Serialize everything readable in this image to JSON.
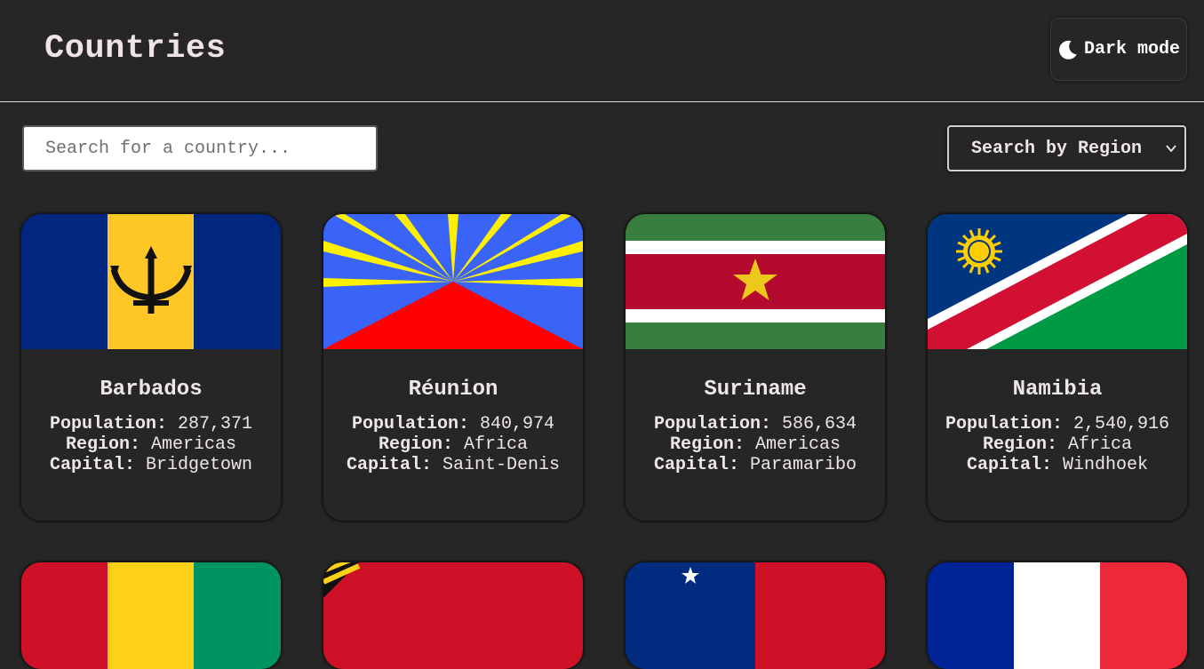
{
  "header": {
    "title": "Countries",
    "theme_toggle_label": "Dark mode",
    "theme_icon": "moon-icon"
  },
  "controls": {
    "search_placeholder": "Search for a country...",
    "search_value": "",
    "region_selected": "Search by Region"
  },
  "labels": {
    "population": "Population:",
    "region": "Region:",
    "capital": "Capital:"
  },
  "countries": [
    {
      "name": "Barbados",
      "population": "287,371",
      "region": "Americas",
      "capital": "Bridgetown"
    },
    {
      "name": "Réunion",
      "population": "840,974",
      "region": "Africa",
      "capital": "Saint-Denis"
    },
    {
      "name": "Suriname",
      "population": "586,634",
      "region": "Americas",
      "capital": "Paramaribo"
    },
    {
      "name": "Namibia",
      "population": "2,540,916",
      "region": "Africa",
      "capital": "Windhoek"
    }
  ],
  "colors": {
    "background": "#262626",
    "text": "#efe6e6"
  }
}
